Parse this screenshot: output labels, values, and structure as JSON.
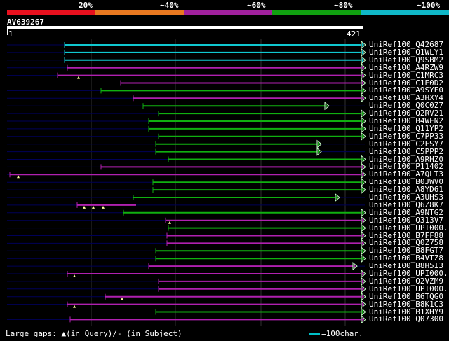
{
  "scale": {
    "labels": [
      "20%",
      "~40%",
      "~60%",
      "~80%",
      "~100%"
    ],
    "colors": [
      "#e8101e",
      "#e87820",
      "#a0209c",
      "#10a010",
      "#10b8c8"
    ]
  },
  "accession": "AV639267",
  "ruler": {
    "start": "1",
    "end": "421"
  },
  "colors": {
    "cyan": "#10c8d0",
    "purple": "#b020b0",
    "green": "#10b010",
    "track": "#000058",
    "grid": "#303030"
  },
  "hits": [
    {
      "label": "UniRef100_Q42687",
      "color": "cyan",
      "s": 92,
      "e": 515,
      "arrow": true,
      "gaps": []
    },
    {
      "label": "UniRef100_Q1WLY1",
      "color": "cyan",
      "s": 92,
      "e": 515,
      "arrow": true,
      "gaps": []
    },
    {
      "label": "UniRef100_Q9SBM2",
      "color": "cyan",
      "s": 92,
      "e": 515,
      "arrow": true,
      "gaps": []
    },
    {
      "label": "UniRef100_A4RZW9",
      "color": "purple",
      "s": 96,
      "e": 515,
      "arrow": true,
      "gaps": []
    },
    {
      "label": "UniRef100_C1MRC3",
      "color": "purple",
      "s": 82,
      "e": 515,
      "arrow": true,
      "gaps": [
        112
      ]
    },
    {
      "label": "UniRef100_C1E0D2",
      "color": "purple",
      "s": 172,
      "e": 515,
      "arrow": true,
      "gaps": []
    },
    {
      "label": "UniRef100_A9SYE0",
      "color": "green",
      "s": 144,
      "e": 515,
      "arrow": true,
      "gaps": []
    },
    {
      "label": "UniRef100_A3HXY4",
      "color": "purple",
      "s": 190,
      "e": 515,
      "arrow": true,
      "gaps": []
    },
    {
      "label": "UniRef100_Q0C0Z7",
      "color": "green",
      "s": 204,
      "e": 463,
      "arrow": true,
      "gaps": []
    },
    {
      "label": "UniRef100_Q2RV21",
      "color": "green",
      "s": 226,
      "e": 515,
      "arrow": true,
      "gaps": []
    },
    {
      "label": "UniRef100_B4WEN2",
      "color": "green",
      "s": 212,
      "e": 515,
      "arrow": true,
      "gaps": []
    },
    {
      "label": "UniRef100_Q11YP2",
      "color": "green",
      "s": 212,
      "e": 515,
      "arrow": true,
      "gaps": []
    },
    {
      "label": "UniRef100_C7PP33",
      "color": "green",
      "s": 226,
      "e": 515,
      "arrow": true,
      "gaps": []
    },
    {
      "label": "UniRef100_C2FSY7",
      "color": "green",
      "s": 222,
      "e": 452,
      "arrow": true,
      "gaps": []
    },
    {
      "label": "UniRef100_C5PPP2",
      "color": "green",
      "s": 222,
      "e": 452,
      "arrow": true,
      "gaps": []
    },
    {
      "label": "UniRef100_A9RHZ0",
      "color": "green",
      "s": 240,
      "e": 515,
      "arrow": true,
      "gaps": []
    },
    {
      "label": "UniRef100_P11402",
      "color": "purple",
      "s": 144,
      "e": 515,
      "arrow": true,
      "gaps": []
    },
    {
      "label": "UniRef100_A7QLT3",
      "color": "purple",
      "s": 14,
      "e": 515,
      "arrow": true,
      "gaps": [
        26
      ]
    },
    {
      "label": "UniRef100_B0JWV0",
      "color": "green",
      "s": 218,
      "e": 515,
      "arrow": true,
      "gaps": []
    },
    {
      "label": "UniRef100_A8YD61",
      "color": "green",
      "s": 218,
      "e": 515,
      "arrow": true,
      "gaps": []
    },
    {
      "label": "UniRef100_A3UHS3",
      "color": "green",
      "s": 190,
      "e": 478,
      "arrow": true,
      "gaps": []
    },
    {
      "label": "UniRef100_Q6Z8K7",
      "color": "purple",
      "s": 110,
      "e": 194,
      "arrow": false,
      "gaps": [
        120,
        133,
        147
      ]
    },
    {
      "label": "UniRef100_A9NTG2",
      "color": "green",
      "s": 176,
      "e": 515,
      "arrow": true,
      "gaps": []
    },
    {
      "label": "UniRef100_Q313V7",
      "color": "purple",
      "s": 236,
      "e": 515,
      "arrow": true,
      "gaps": [
        242
      ]
    },
    {
      "label": "UniRef100_UPI000...",
      "color": "green",
      "s": 240,
      "e": 515,
      "arrow": true,
      "gaps": []
    },
    {
      "label": "UniRef100_B7FF88",
      "color": "purple",
      "s": 238,
      "e": 515,
      "arrow": true,
      "gaps": []
    },
    {
      "label": "UniRef100_Q0Z758",
      "color": "purple",
      "s": 238,
      "e": 515,
      "arrow": true,
      "gaps": []
    },
    {
      "label": "UniRef100_B8FGT7",
      "color": "green",
      "s": 222,
      "e": 515,
      "arrow": true,
      "gaps": []
    },
    {
      "label": "UniRef100_B4VTZ8",
      "color": "green",
      "s": 222,
      "e": 515,
      "arrow": true,
      "gaps": []
    },
    {
      "label": "UniRef100_B8H5I3",
      "color": "purple",
      "s": 212,
      "e": 503,
      "arrow": true,
      "gaps": []
    },
    {
      "label": "UniRef100_UPI000...",
      "color": "purple",
      "s": 96,
      "e": 515,
      "arrow": true,
      "gaps": [
        106
      ]
    },
    {
      "label": "UniRef100_Q2VZM9",
      "color": "purple",
      "s": 226,
      "e": 515,
      "arrow": true,
      "gaps": []
    },
    {
      "label": "UniRef100_UPI000...",
      "color": "purple",
      "s": 226,
      "e": 515,
      "arrow": true,
      "gaps": []
    },
    {
      "label": "UniRef100_B6TQG0",
      "color": "purple",
      "s": 150,
      "e": 515,
      "arrow": true,
      "gaps": [
        174
      ]
    },
    {
      "label": "UniRef100_B8K1C3",
      "color": "purple",
      "s": 96,
      "e": 515,
      "arrow": true,
      "gaps": [
        106
      ]
    },
    {
      "label": "UniRef100_B1XHY9",
      "color": "green",
      "s": 222,
      "e": 515,
      "arrow": true,
      "gaps": []
    },
    {
      "label": "UniRef100_Q07300",
      "color": "purple",
      "s": 100,
      "e": 515,
      "arrow": true,
      "gaps": []
    }
  ],
  "footer": {
    "gaps_text": "Large gaps: ▲(in Query)/- (in Subject)",
    "key_text": "=100char."
  }
}
